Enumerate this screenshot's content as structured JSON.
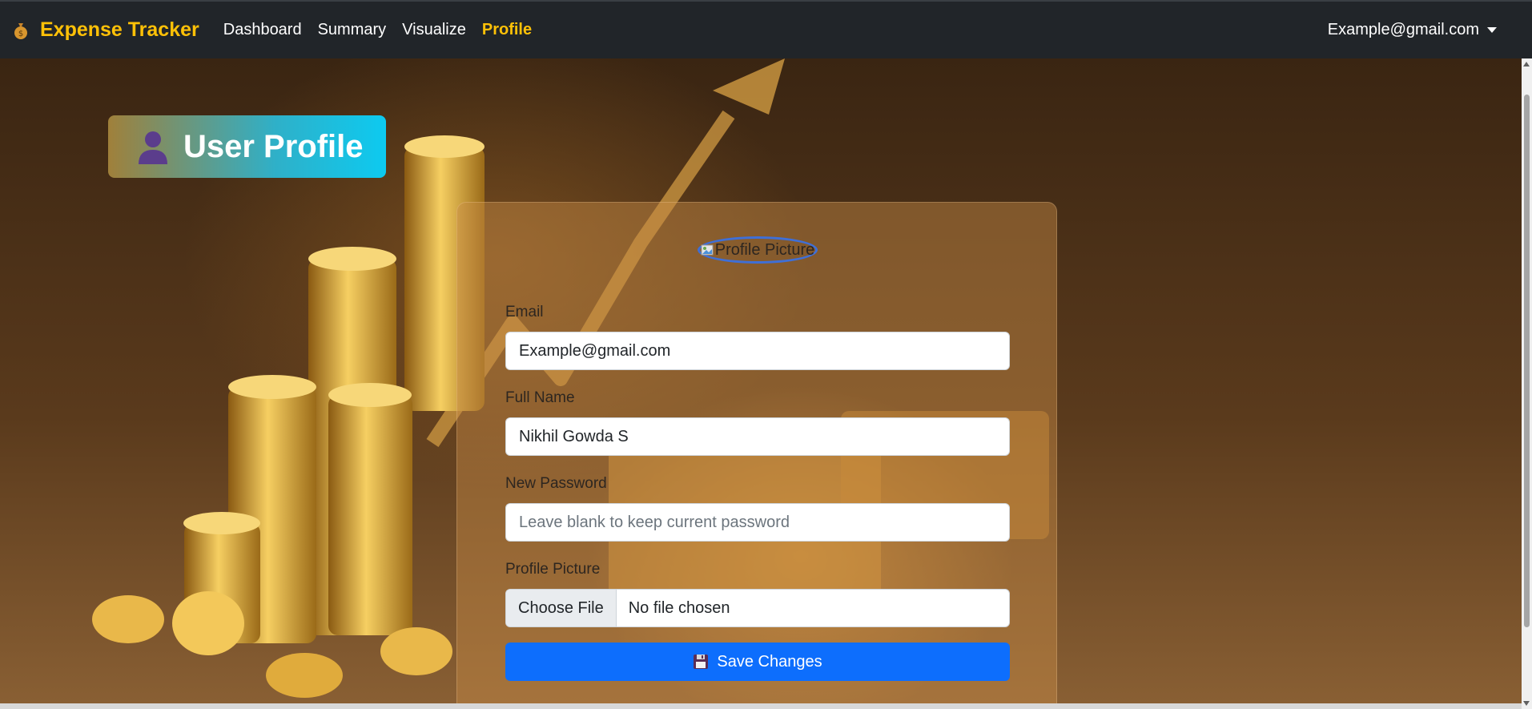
{
  "navbar": {
    "brand": "Expense Tracker",
    "brand_icon": "money-bag-icon",
    "links": [
      {
        "label": "Dashboard",
        "active": false
      },
      {
        "label": "Summary",
        "active": false
      },
      {
        "label": "Visualize",
        "active": false
      },
      {
        "label": "Profile",
        "active": true
      }
    ],
    "user_email": "Example@gmail.com"
  },
  "page": {
    "title": "User Profile",
    "title_icon": "user-silhouette-icon"
  },
  "form": {
    "avatar_alt": "Profile Picture",
    "email": {
      "label": "Email",
      "value": "Example@gmail.com"
    },
    "full_name": {
      "label": "Full Name",
      "value": "Nikhil Gowda S"
    },
    "new_password": {
      "label": "New Password",
      "placeholder": "Leave blank to keep current password"
    },
    "profile_picture": {
      "label": "Profile Picture",
      "button": "Choose File",
      "status": "No file chosen"
    },
    "save_label": "Save Changes",
    "save_icon": "floppy-disk-icon"
  },
  "colors": {
    "navbar_bg": "#212529",
    "brand": "#ffc107",
    "primary": "#0d6efd",
    "badge_gradient_end": "#0dcaf0"
  }
}
